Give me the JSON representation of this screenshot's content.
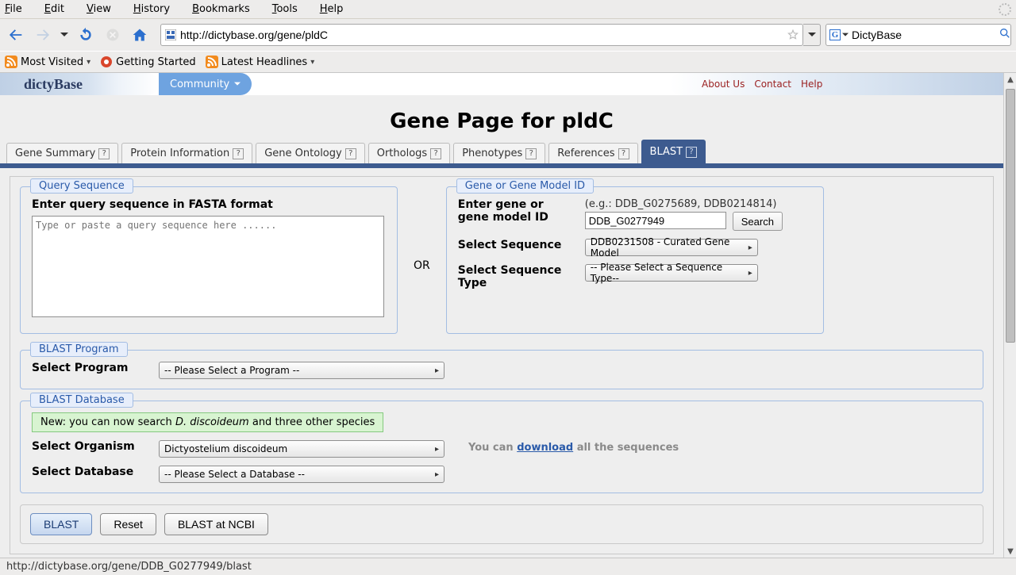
{
  "menubar": {
    "file": "File",
    "edit": "Edit",
    "view": "View",
    "history": "History",
    "bookmarks": "Bookmarks",
    "tools": "Tools",
    "help": "Help"
  },
  "nav": {
    "back": "Back",
    "forward": "Forward",
    "reload": "Reload",
    "stop": "Stop",
    "home": "Home"
  },
  "url": {
    "value": "http://dictybase.org/gene/pldC"
  },
  "searchbox": {
    "engine_label": "G",
    "value": "DictyBase"
  },
  "bookmarks": {
    "most": "Most Visited",
    "getting": "Getting Started",
    "latest": "Latest Headlines"
  },
  "site": {
    "logo": "dictyBase",
    "nav_item": "Community",
    "links": {
      "about": "About Us",
      "contact": "Contact",
      "help": "Help"
    }
  },
  "title": "Gene Page for pldC",
  "tabs": [
    {
      "label": "Gene Summary"
    },
    {
      "label": "Protein Information"
    },
    {
      "label": "Gene Ontology"
    },
    {
      "label": "Orthologs"
    },
    {
      "label": "Phenotypes"
    },
    {
      "label": "References"
    },
    {
      "label": "BLAST"
    }
  ],
  "query": {
    "legend": "Query Sequence",
    "label": "Enter query sequence in FASTA format",
    "placeholder": "Type or paste a query sequence here ......"
  },
  "or": "OR",
  "geneid": {
    "legend": "Gene or Gene Model ID",
    "label": "Enter gene or gene model ID",
    "hint": "(e.g.: DDB_G0275689, DDB0214814)",
    "value": "DDB_G0277949",
    "search_btn": "Search",
    "sel_seq_label": "Select Sequence",
    "sel_seq_value": "DDB0231508 - Curated Gene Model",
    "sel_type_label": "Select Sequence Type",
    "sel_type_value": "-- Please Select a Sequence Type--"
  },
  "program": {
    "legend": "BLAST Program",
    "label": "Select Program",
    "value": "-- Please Select a Program --"
  },
  "database": {
    "legend": "BLAST Database",
    "note_pre": "New: you can now search ",
    "note_it": "D. discoideum",
    "note_post": " and three other species",
    "org_label": "Select Organism",
    "org_value": "Dictyostelium discoideum",
    "db_label": "Select Database",
    "db_value": "-- Please Select a Database --",
    "dl_pre": "You can ",
    "dl_link": "download",
    "dl_post": " all the sequences"
  },
  "buttons": {
    "blast": "BLAST",
    "reset": "Reset",
    "ncbi": "BLAST at NCBI"
  },
  "status": "http://dictybase.org/gene/DDB_G0277949/blast"
}
